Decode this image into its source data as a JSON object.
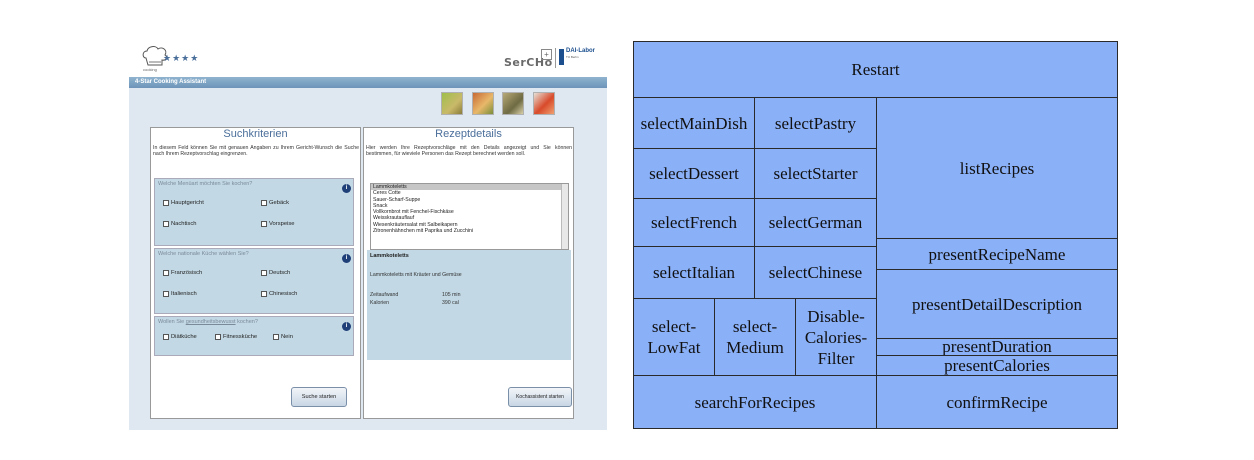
{
  "app": {
    "stars": "★★★★",
    "sercho": "SerCHo",
    "dai_logo": "DAI-Labor",
    "dai_sub": "TU Berlin",
    "title": "4-Star Cooking Assistant",
    "left_panel": {
      "title": "Suchkriterien",
      "description": "In diesem Feld können Sie mit genauen Angaben zu Ihrem Gericht-Wunsch die Suche nach Ihrem Rezeptvorschlag eingrenzen.",
      "q1": "Welche Menüart möchten Sie kochen?",
      "q1_options": [
        "Hauptgericht",
        "Gebäck",
        "Nachtisch",
        "Vorspeise"
      ],
      "q2": "Welche nationale Küche wählen Sie?",
      "q2_options": [
        "Französisch",
        "Deutsch",
        "Italienisch",
        "Chinesisch"
      ],
      "q3_prefix": "Wollen Sie ",
      "q3_link": "gesundheitsbewusst",
      "q3_suffix": " kochen?",
      "q3_options": [
        "Diätküche",
        "Fitnessküche",
        "Nein"
      ],
      "search_button": "Suche starten"
    },
    "right_panel": {
      "title": "Rezeptdetails",
      "description": "Hier werden Ihre Rezeptvorschläge mit den Details angezeigt und Sie können bestimmen, für wieviele Personen das Rezept berechnet werden soll.",
      "recipes": [
        "Lammkoteletts",
        "Ceres Cotte",
        "Sauer-Scharf-Suppe",
        "Snack",
        "Vollkornbrot mit Fenchel-Fischkäse",
        "Weisskrautauflauf",
        "Wiesenkräutersalat mit Salbeikapern",
        "Zitronenhähnchen mit Paprika und Zucchini"
      ],
      "detail_name": "Lammkoteletts",
      "detail_desc": "Lammkoteletts mit Kräuter und Gemüse",
      "duration_label": "Zeitaufwand",
      "duration_value": "105 min",
      "calories_label": "Kalorien",
      "calories_value": "390 cal",
      "cook_button": "Kochassistent starten"
    }
  },
  "diagram": {
    "background": "#8ab0f8",
    "cells": {
      "restart": "Restart",
      "select_main_dish": "selectMainDish",
      "select_pastry": "selectPastry",
      "select_dessert": "selectDessert",
      "select_starter": "selectStarter",
      "select_french": "selectFrench",
      "select_german": "selectGerman",
      "select_italian": "selectItalian",
      "select_chinese": "selectChinese",
      "select_low_fat": "select-\nLowFat",
      "select_medium": "select-\nMedium",
      "disable_calories_filter": "Disable-\nCalories-\nFilter",
      "list_recipes": "listRecipes",
      "present_recipe_name": "presentRecipeName",
      "present_detail_description": "presentDetailDescription",
      "present_duration": "presentDuration",
      "present_calories": "presentCalories",
      "search_for_recipes": "searchForRecipes",
      "confirm_recipe": "confirmRecipe"
    }
  }
}
